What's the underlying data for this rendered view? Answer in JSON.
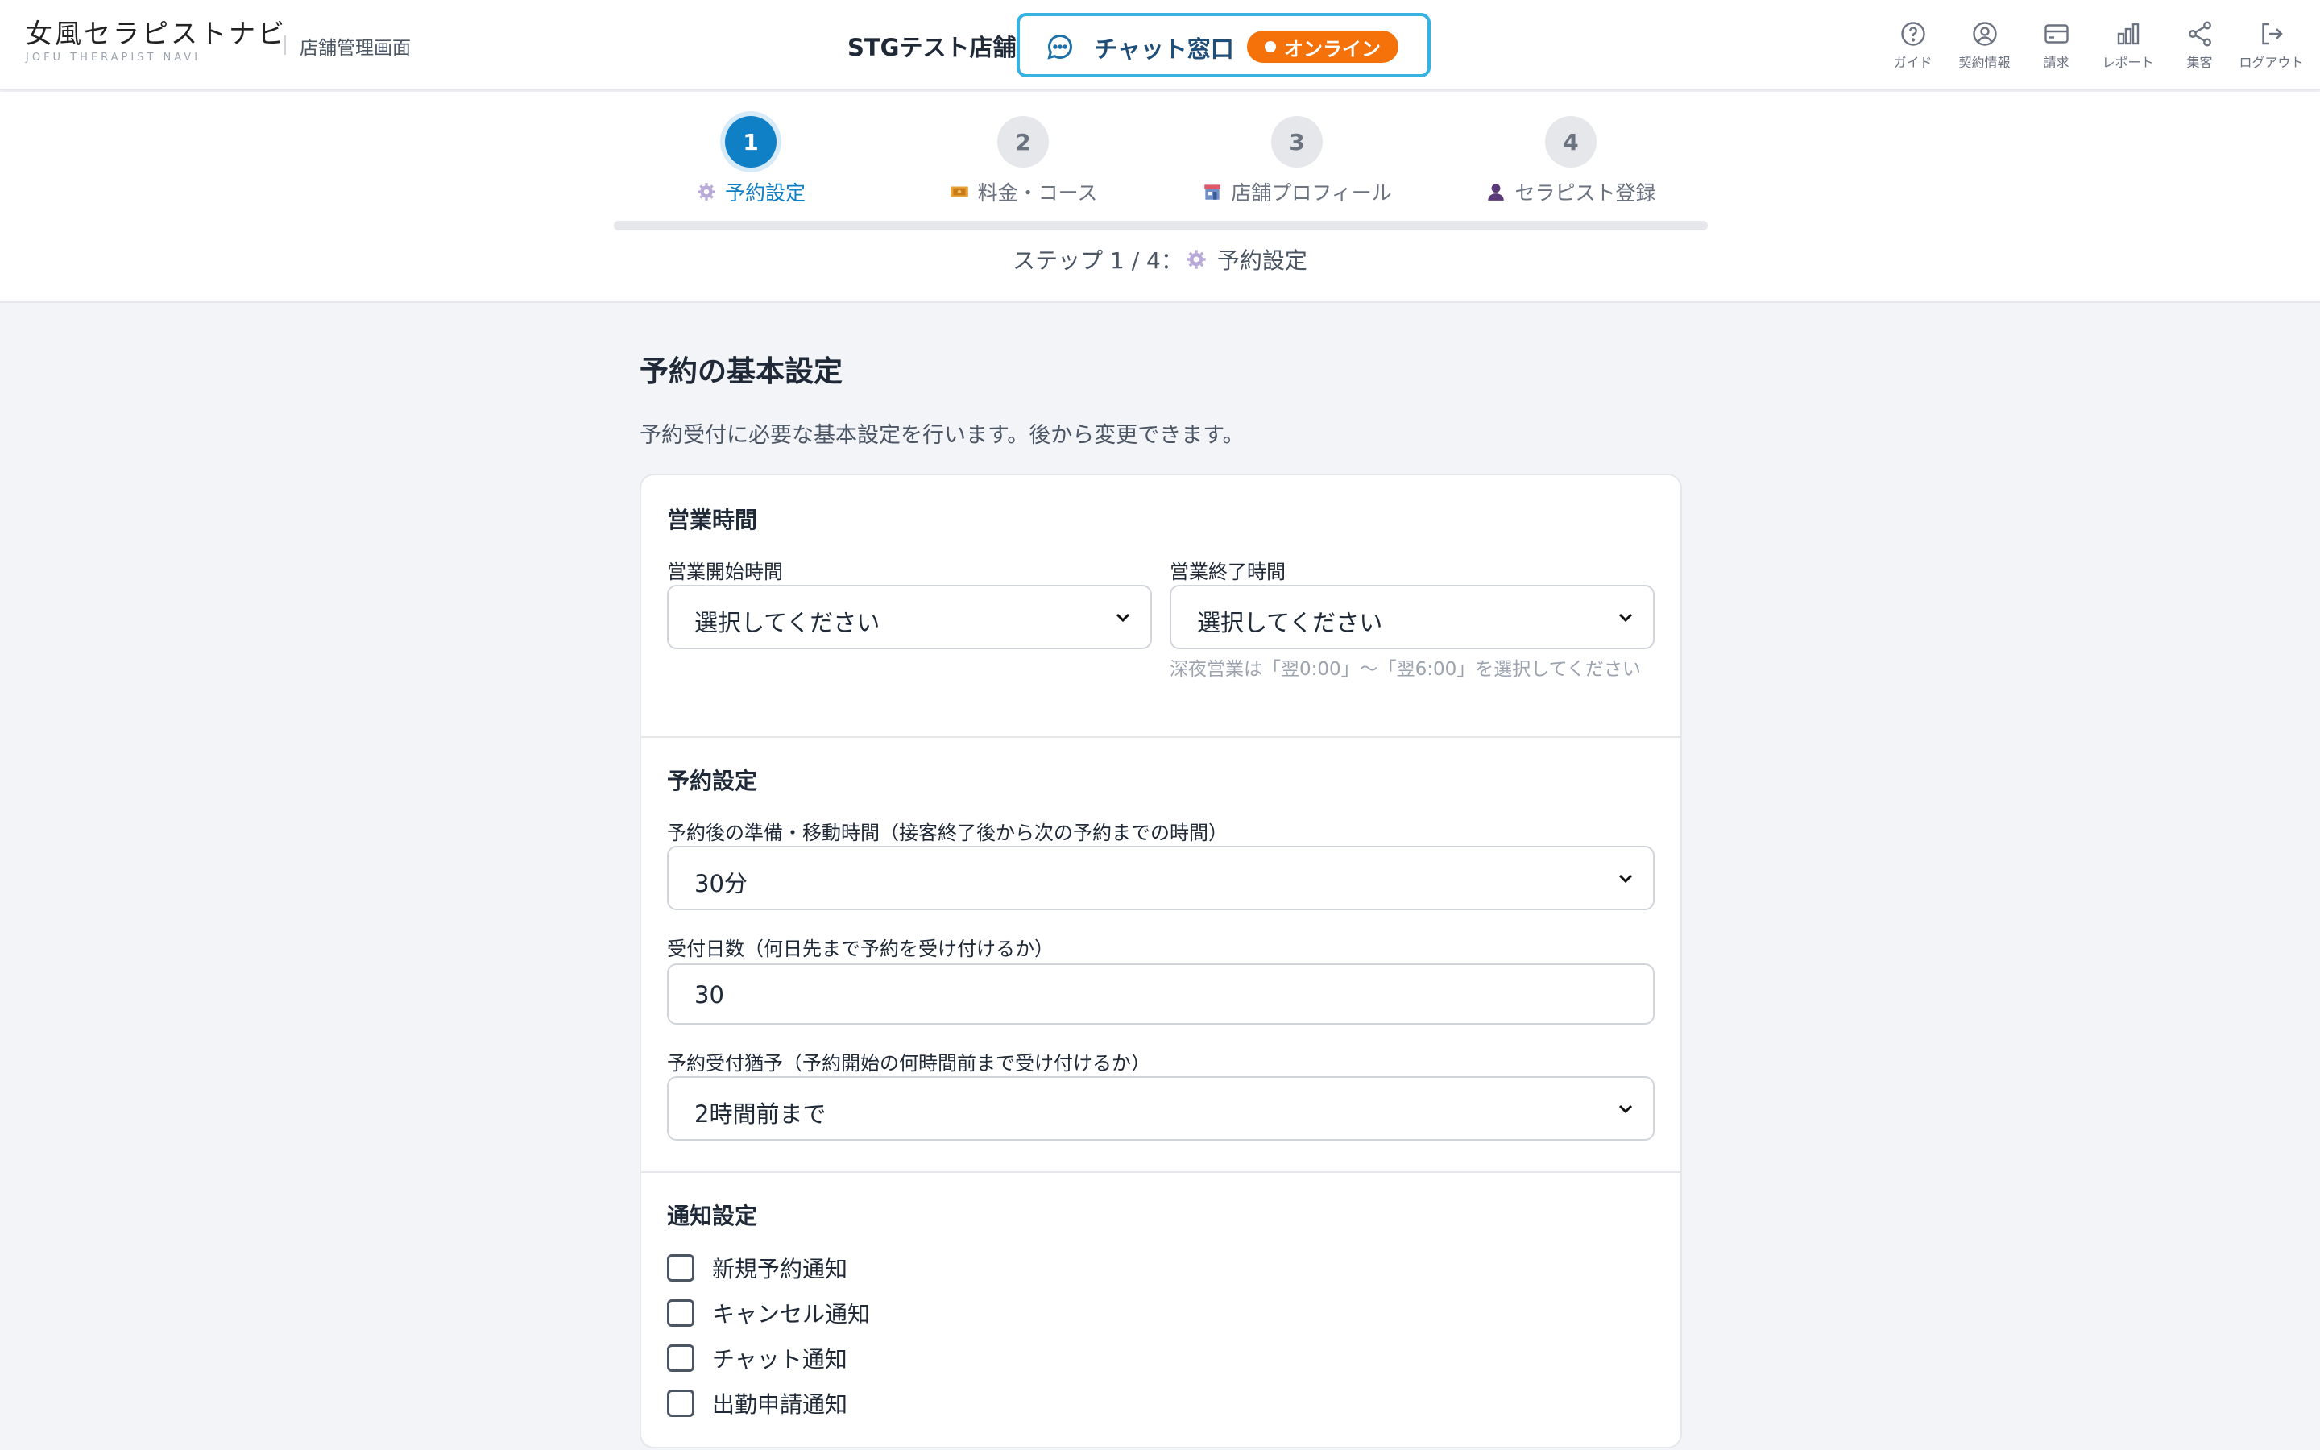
{
  "header": {
    "logo_main": "女風セラピストナビ",
    "logo_sub": "JOFU THERAPIST NAVI",
    "admin_label": "店舗管理画面",
    "store_name": "STGテスト店舗",
    "chat_label": "チャット窓口",
    "online_status": "オンライン",
    "nav": [
      {
        "label": "ガイド",
        "icon": "help-circle-icon"
      },
      {
        "label": "契約情報",
        "icon": "user-circle-icon"
      },
      {
        "label": "請求",
        "icon": "credit-card-icon"
      },
      {
        "label": "レポート",
        "icon": "bar-chart-icon"
      },
      {
        "label": "集客",
        "icon": "share-icon"
      },
      {
        "label": "ログアウト",
        "icon": "logout-icon"
      }
    ]
  },
  "stepper": {
    "steps": [
      {
        "number": "1",
        "label": "予約設定",
        "icon": "gear-icon"
      },
      {
        "number": "2",
        "label": "料金・コース",
        "icon": "money-icon"
      },
      {
        "number": "3",
        "label": "店舗プロフィール",
        "icon": "store-icon"
      },
      {
        "number": "4",
        "label": "セラピスト登録",
        "icon": "person-icon"
      }
    ],
    "current": 1,
    "caption_prefix": "ステップ 1 / 4：",
    "caption_label": "予約設定"
  },
  "main": {
    "title": "予約の基本設定",
    "description": "予約受付に必要な基本設定を行います。後から変更できます。"
  },
  "business_hours": {
    "section_title": "営業時間",
    "start_label": "営業開始時間",
    "start_value": "選択してください",
    "end_label": "営業終了時間",
    "end_value": "選択してください",
    "hint": "深夜営業は「翌0:00」〜「翌6:00」を選択してください"
  },
  "reservation": {
    "section_title": "予約設定",
    "prep_label": "予約後の準備・移動時間（接客終了後から次の予約までの時間）",
    "prep_value": "30分",
    "days_label": "受付日数（何日先まで予約を受け付けるか）",
    "days_value": "30",
    "grace_label": "予約受付猶予（予約開始の何時間前まで受け付けるか）",
    "grace_value": "2時間前まで"
  },
  "notifications": {
    "section_title": "通知設定",
    "items": [
      {
        "label": "新規予約通知",
        "checked": false
      },
      {
        "label": "キャンセル通知",
        "checked": false
      },
      {
        "label": "チャット通知",
        "checked": false
      },
      {
        "label": "出勤申請通知",
        "checked": false
      }
    ]
  },
  "colors": {
    "accent": "#0f7fc6",
    "chat_border": "#38b2e0",
    "online_badge": "#f5720a",
    "background": "#f3f4f8"
  }
}
